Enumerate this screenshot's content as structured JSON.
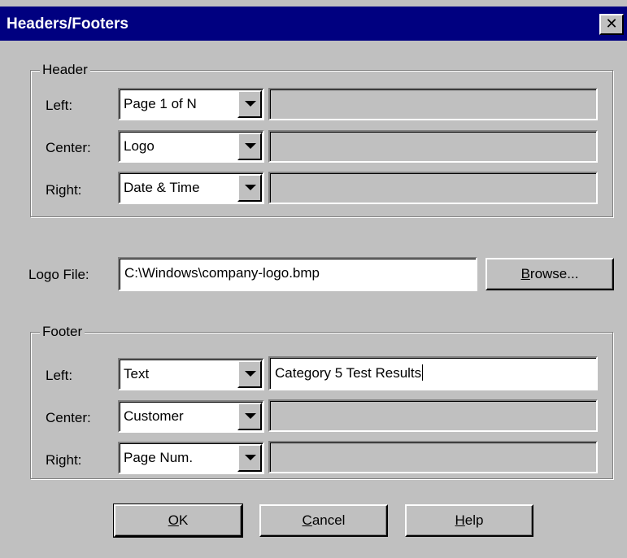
{
  "window": {
    "title": "Headers/Footers",
    "close_glyph": "✕"
  },
  "header": {
    "group_label": "Header",
    "rows": [
      {
        "label": "Left:",
        "selected": "Page 1 of N",
        "text": ""
      },
      {
        "label": "Center:",
        "selected": "Logo",
        "text": ""
      },
      {
        "label": "Right:",
        "selected": "Date & Time",
        "text": ""
      }
    ]
  },
  "logo_file": {
    "label": "Logo File:",
    "value": "C:\\Windows\\company-logo.bmp",
    "browse_first": "B",
    "browse_rest": "rowse..."
  },
  "footer": {
    "group_label": "Footer",
    "rows": [
      {
        "label": "Left:",
        "selected": "Text",
        "text": "Category 5 Test Results"
      },
      {
        "label": "Center:",
        "selected": "Customer",
        "text": ""
      },
      {
        "label": "Right:",
        "selected": "Page Num.",
        "text": ""
      }
    ]
  },
  "buttons": {
    "ok_first": "O",
    "ok_rest": "K",
    "cancel_first": "C",
    "cancel_rest": "ancel",
    "help_first": "H",
    "help_rest": "elp"
  },
  "icons": {
    "combo_arrow": "chevron-down-icon",
    "close": "close-icon"
  }
}
